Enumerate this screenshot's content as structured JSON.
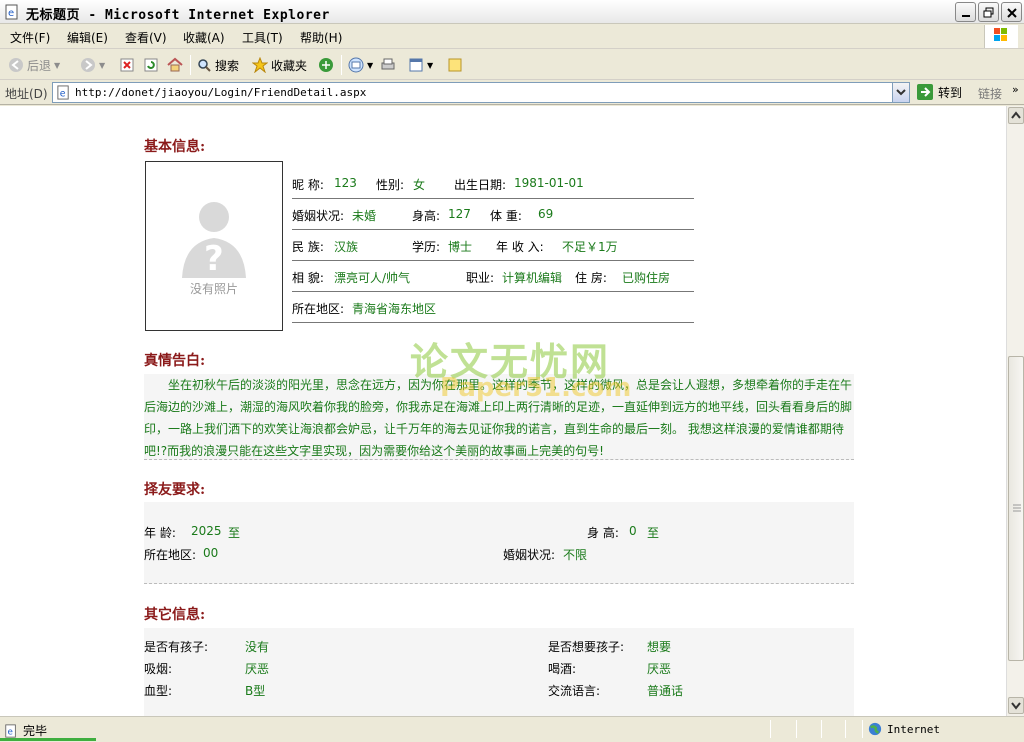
{
  "window": {
    "title": "无标题页 - Microsoft Internet Explorer"
  },
  "menu": [
    "文件(F)",
    "编辑(E)",
    "查看(V)",
    "收藏(A)",
    "工具(T)",
    "帮助(H)"
  ],
  "toolbar": {
    "back": "后退",
    "search": "搜索",
    "favorites": "收藏夹"
  },
  "address": {
    "label": "地址(D)",
    "url": "http://donet/jiaoyou/Login/FriendDetail.aspx",
    "go": "转到",
    "links": "链接"
  },
  "basic": {
    "title": "基本信息:",
    "photo_caption": "没有照片",
    "nickname_label": "昵 称:",
    "nickname": "123",
    "gender_label": "性别:",
    "gender": "女",
    "birth_label": "出生日期:",
    "birth": "1981-01-01",
    "marital_label": "婚姻状况:",
    "marital": "未婚",
    "height_label": "身高:",
    "height": "127",
    "weight_label": "体 重:",
    "weight": "69",
    "ethnic_label": "民 族:",
    "ethnic": "汉族",
    "edu_label": "学历:",
    "edu": "博士",
    "income_label": "年 收 入:",
    "income": "不足￥1万",
    "looks_label": "相 貌:",
    "looks": "漂亮可人/帅气",
    "job_label": "职业:",
    "job": "计算机编辑",
    "housing_label": "住 房:",
    "housing": "已购住房",
    "region_label": "所在地区:",
    "region": "青海省海东地区"
  },
  "intro": {
    "title": "真情告白:",
    "text": "坐在初秋午后的淡淡的阳光里，思念在远方，因为你在那里。这样的季节，这样的微风，总是会让人遐想，多想牵着你的手走在午后海边的沙滩上，潮湿的海风吹着你我的脸旁，你我赤足在海滩上印上两行清晰的足迹，一直延伸到远方的地平线，回头看看身后的脚印，一路上我们洒下的欢笑让海浪都会妒忌，让千万年的海去见证你我的诺言，直到生命的最后一刻。 我想这样浪漫的爱情谁都期待吧!?而我的浪漫只能在这些文字里实现，因为需要你给这个美丽的故事画上完美的句号!"
  },
  "requirements": {
    "title": "择友要求:",
    "age_label": "年 龄:",
    "age_value": "2025",
    "age_to": "至",
    "height_label": "身 高:",
    "height_value": "0",
    "height_to": "至",
    "region_label": "所在地区:",
    "region_value": "00",
    "marital_label": "婚姻状况:",
    "marital_value": "不限"
  },
  "other": {
    "title": "其它信息:",
    "children_label": "是否有孩子:",
    "children": "没有",
    "want_children_label": "是否想要孩子:",
    "want_children": "想要",
    "smoke_label": "吸烟:",
    "smoke": "厌恶",
    "drink_label": "喝酒:",
    "drink": "厌恶",
    "blood_label": "血型:",
    "blood": "B型",
    "language_label": "交流语言:",
    "language": "普通话"
  },
  "watermark": {
    "line1": "论文无忧网",
    "line2": "Paper51.com"
  },
  "status": {
    "text": "完毕",
    "zone": "Internet"
  },
  "colors": {
    "section_title": "#8b1a1a",
    "value_green": "#1a7a1a"
  }
}
